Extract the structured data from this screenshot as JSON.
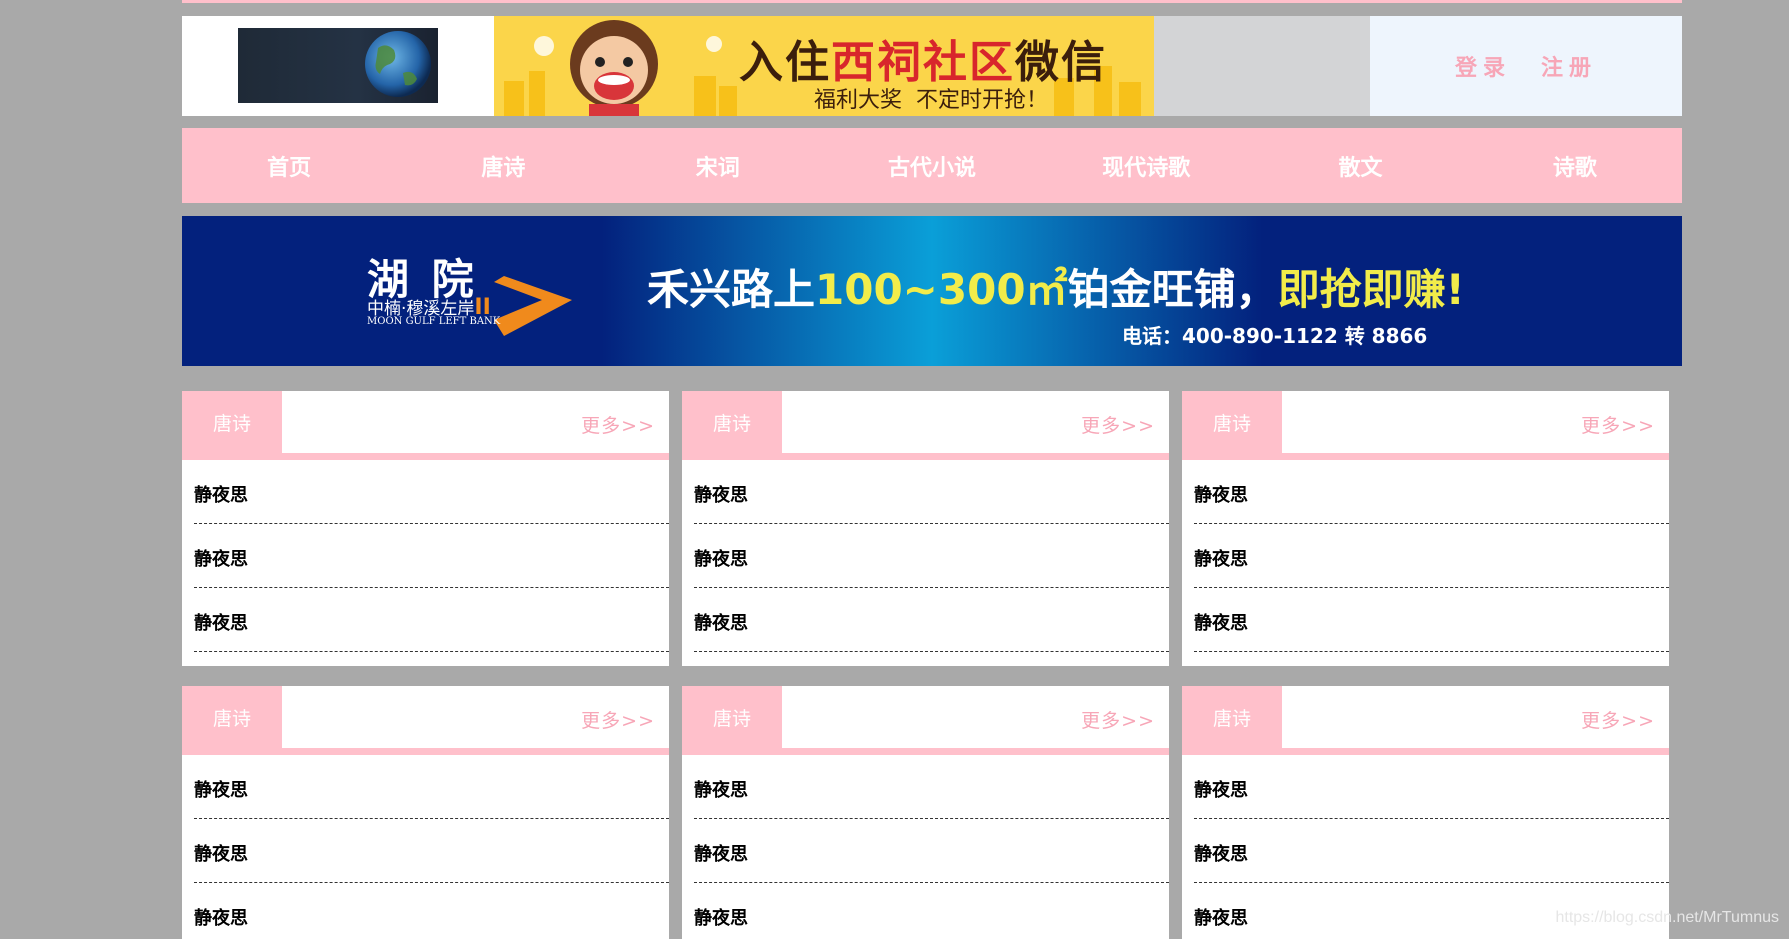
{
  "header": {
    "ad_title_1": "入住",
    "ad_title_2": "西祠社区",
    "ad_title_3": "微信",
    "ad_subtitle": "福利大奖  不定时开抢！",
    "login_label": "登录",
    "register_label": "注册"
  },
  "nav": {
    "items": [
      {
        "label": "首页"
      },
      {
        "label": "唐诗"
      },
      {
        "label": "宋词"
      },
      {
        "label": "古代小说"
      },
      {
        "label": "现代诗歌"
      },
      {
        "label": "散文"
      },
      {
        "label": "诗歌"
      }
    ]
  },
  "banner": {
    "brand_title": "湖 院",
    "brand_sub": "中楠·穆溪左岸",
    "brand_sub_roman": "II",
    "brand_en": "MOON GULF LEFT BANK",
    "headline_1": "禾兴路上",
    "headline_2": "100~300㎡",
    "headline_3": "铂金旺铺，",
    "headline_4": "即抢即赚!",
    "phone": "电话：400-890-1122 转 8866"
  },
  "boxes": [
    {
      "title": "唐诗",
      "more": "更多>>",
      "items": [
        "静夜思",
        "静夜思",
        "静夜思"
      ]
    },
    {
      "title": "唐诗",
      "more": "更多>>",
      "items": [
        "静夜思",
        "静夜思",
        "静夜思"
      ]
    },
    {
      "title": "唐诗",
      "more": "更多>>",
      "items": [
        "静夜思",
        "静夜思",
        "静夜思"
      ]
    },
    {
      "title": "唐诗",
      "more": "更多>>",
      "items": [
        "静夜思",
        "静夜思",
        "静夜思"
      ]
    },
    {
      "title": "唐诗",
      "more": "更多>>",
      "items": [
        "静夜思",
        "静夜思",
        "静夜思"
      ]
    },
    {
      "title": "唐诗",
      "more": "更多>>",
      "items": [
        "静夜思",
        "静夜思",
        "静夜思"
      ]
    }
  ],
  "watermark": "https://blog.csdn.net/MrTumnus",
  "colors": {
    "accent_pink": "#ffc0cb",
    "link_pink": "#f7a6b7",
    "banner_navy": "#03217d",
    "background_gray": "#a9a9a9"
  }
}
